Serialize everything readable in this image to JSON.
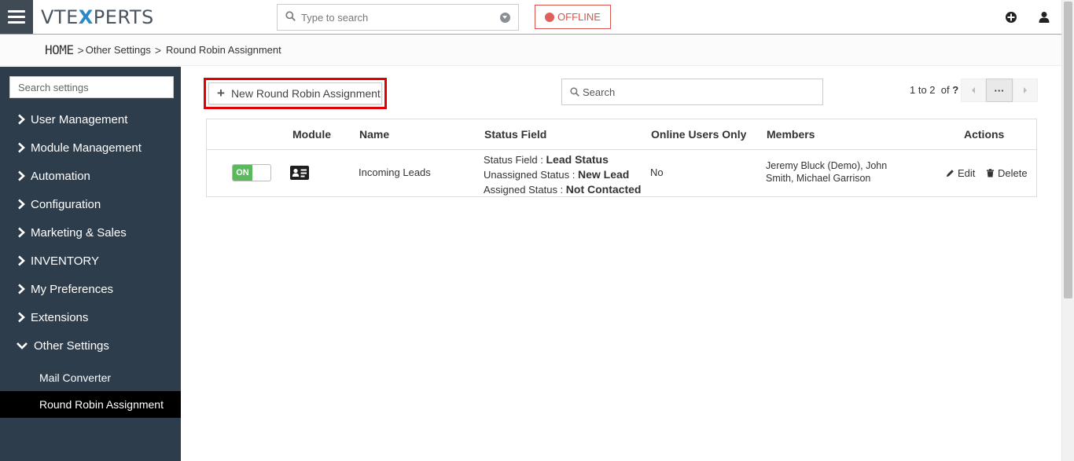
{
  "header": {
    "logo_left": "VTE",
    "logo_x": "X",
    "logo_right": "PERTS",
    "search_placeholder": "Type to search",
    "offline_label": "OFFLINE",
    "colors": {
      "accent": "#2a89c8",
      "offline": "#d9534f",
      "sidebar": "#2e3d4c",
      "highlight": "#e20000",
      "toggle_on": "#5cb85c"
    },
    "icons": [
      "menu-icon",
      "search-icon",
      "chevron-down-icon",
      "plus-circle-icon",
      "user-icon"
    ]
  },
  "breadcrumb": {
    "home": "HOME",
    "sep1": ">",
    "parent": "Other Settings",
    "sep2": ">",
    "current": "Round Robin Assignment"
  },
  "sidebar": {
    "search_placeholder": "Search settings",
    "items": [
      {
        "label": "User Management"
      },
      {
        "label": "Module Management"
      },
      {
        "label": "Automation"
      },
      {
        "label": "Configuration"
      },
      {
        "label": "Marketing & Sales"
      },
      {
        "label": "INVENTORY"
      },
      {
        "label": "My Preferences"
      },
      {
        "label": "Extensions"
      },
      {
        "label": "Other Settings"
      }
    ],
    "sub_items": [
      {
        "label": "Mail Converter"
      },
      {
        "label": "Round Robin Assignment"
      }
    ]
  },
  "main": {
    "new_button": "New Round Robin Assignment",
    "search_placeholder": "Search",
    "pagination": {
      "range": "1 to 2",
      "of": "of",
      "total": "?"
    },
    "pg_more": "···",
    "columns": {
      "module": "Module",
      "name": "Name",
      "status_field": "Status Field",
      "online_users": "Online Users Only",
      "members": "Members",
      "actions": "Actions"
    },
    "row": {
      "toggle": "ON",
      "name": "Incoming Leads",
      "status_field_label": "Status Field :",
      "status_field_value": "Lead Status",
      "unassigned_label": "Unassigned Status :",
      "unassigned_value": "New Lead",
      "assigned_label": "Assigned Status :",
      "assigned_value": "Not Contacted",
      "online_users": "No",
      "members_line1": "Jeremy Bluck (Demo), John",
      "members_line2": "Smith, Michael Garrison",
      "edit": "Edit",
      "delete": "Delete"
    }
  }
}
